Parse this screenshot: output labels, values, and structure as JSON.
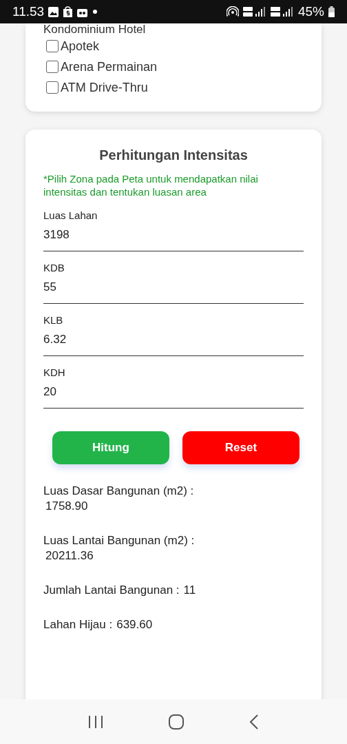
{
  "status_bar": {
    "time": "11.53",
    "battery": "45%"
  },
  "facility_list": {
    "cut_label": "Kondominium Hotel",
    "items": [
      {
        "label": "Apotek",
        "checked": false
      },
      {
        "label": "Arena Permainan",
        "checked": false
      },
      {
        "label": "ATM Drive-Thru",
        "checked": false
      }
    ]
  },
  "intensity_card": {
    "title": "Perhitungan Intensitas",
    "note": "*Pilih Zona pada Peta untuk mendapatkan nilai intensitas dan tentukan luasan area",
    "fields": [
      {
        "label": "Luas Lahan",
        "value": "3198"
      },
      {
        "label": "KDB",
        "value": "55"
      },
      {
        "label": "KLB",
        "value": "6.32"
      },
      {
        "label": "KDH",
        "value": "20"
      }
    ],
    "buttons": [
      {
        "label": "Hitung",
        "kind": "primary"
      },
      {
        "label": "Reset",
        "kind": "danger"
      }
    ],
    "results": [
      {
        "label": "Luas Dasar Bangunan (m2) :",
        "value": "1758.90",
        "kind": "stacked"
      },
      {
        "label": "Luas Lantai Bangunan (m2) :",
        "value": "20211.36",
        "kind": "stacked"
      },
      {
        "label": "Jumlah Lantai Bangunan :",
        "value": "11",
        "kind": "inline"
      },
      {
        "label": "Lahan Hijau :",
        "value": "639.60",
        "kind": "inline"
      }
    ]
  }
}
